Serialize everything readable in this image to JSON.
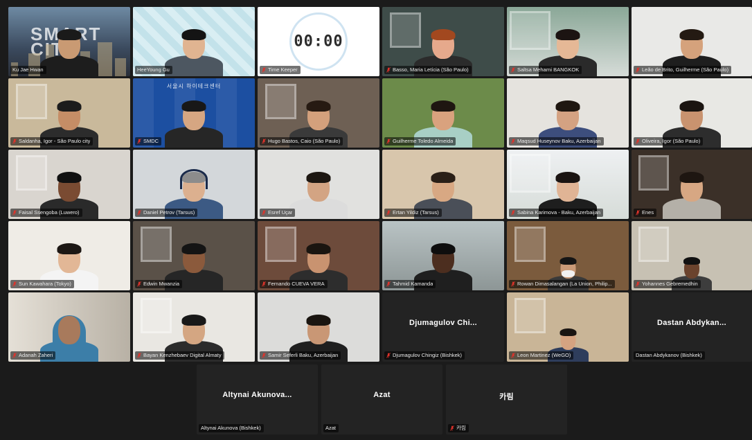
{
  "meeting": {
    "participants": [
      {
        "id": "p01",
        "name": "Ku Jae Hwan",
        "video": true,
        "mic_muted": false,
        "active_speaker": false,
        "bg": "#2d3a4e",
        "skin": "#c99a73",
        "hair": "#1a1a1a",
        "shirt": "#1d1d1d",
        "scene": "smartcity"
      },
      {
        "id": "p02",
        "name": "HeeYoung Gu",
        "video": true,
        "mic_muted": false,
        "active_speaker": true,
        "bg": "#cfe6ee",
        "skin": "#e0b491",
        "hair": "#141414",
        "shirt": "#4d5761",
        "scene": "pattern"
      },
      {
        "id": "p03",
        "name": "Time Keeper",
        "video": true,
        "mic_muted": true,
        "active_speaker": false,
        "bg": "#ffffff",
        "scene": "timer",
        "timer": "00:00"
      },
      {
        "id": "p04",
        "name": "Basso, Maria Letícia (São Paulo)",
        "video": true,
        "mic_muted": true,
        "active_speaker": false,
        "bg": "#3e4c49",
        "skin": "#e6a98c",
        "hair": "#a2481f",
        "shirt": "#2b2b2b",
        "scene": "room"
      },
      {
        "id": "p05",
        "name": "Saltsa Meharni BANGKOK",
        "video": true,
        "mic_muted": true,
        "active_speaker": false,
        "bg": "#8aa797",
        "skin": "#e5b896",
        "hair": "#1c1412",
        "shirt": "#2a2a2a",
        "scene": "office"
      },
      {
        "id": "p06",
        "name": "Leão de Brito, Guilherme (São Paulo)",
        "video": true,
        "mic_muted": true,
        "active_speaker": false,
        "bg": "#e9e9e7",
        "skin": "#d5a27c",
        "hair": "#241a13",
        "shirt": "#1e1e1e",
        "scene": "plain"
      },
      {
        "id": "p07",
        "name": "Saldanha, Igor - São Paulo city",
        "video": true,
        "mic_muted": true,
        "active_speaker": false,
        "bg": "#c9b99b",
        "skin": "#c58d66",
        "hair": "#1c1c1c",
        "shirt": "#2c2c2c",
        "scene": "room"
      },
      {
        "id": "p08",
        "name": "SMDC",
        "video": true,
        "mic_muted": true,
        "active_speaker": false,
        "bg": "#1c4fa1",
        "skin": "#d6a682",
        "hair": "#181818",
        "shirt": "#262626",
        "scene": "banner",
        "banner_text": "서울시 하이테크센터"
      },
      {
        "id": "p09",
        "name": "Hugo Bastos, Caio (São Paulo)",
        "video": true,
        "mic_muted": true,
        "active_speaker": false,
        "bg": "#6e6054",
        "skin": "#d3a07c",
        "hair": "#261a12",
        "shirt": "#3a3a3a",
        "scene": "room"
      },
      {
        "id": "p10",
        "name": "Guilherme Toledo Almeida",
        "video": true,
        "mic_muted": true,
        "active_speaker": false,
        "bg": "#6c8b4a",
        "skin": "#d9a27e",
        "hair": "#1e1611",
        "shirt": "#a8cfc5",
        "scene": "plain"
      },
      {
        "id": "p11",
        "name": "Maqsud Huseynov Baku, Azerbaijan",
        "video": true,
        "mic_muted": true,
        "active_speaker": false,
        "bg": "#e5e3de",
        "skin": "#d4a282",
        "hair": "#1f1711",
        "shirt": "#3d4e7d",
        "scene": "plain"
      },
      {
        "id": "p12",
        "name": "Oliveira, Igor (São Paulo)",
        "video": true,
        "mic_muted": true,
        "active_speaker": false,
        "bg": "#e8e8e4",
        "skin": "#c9936f",
        "hair": "#1a1410",
        "shirt": "#2d2d2d",
        "scene": "plain"
      },
      {
        "id": "p13",
        "name": "Faisal Ssengoba (Luwero)",
        "video": true,
        "mic_muted": true,
        "active_speaker": false,
        "bg": "#d9d5cf",
        "skin": "#7a4b32",
        "hair": "#111111",
        "shirt": "#2a2a2a",
        "scene": "room"
      },
      {
        "id": "p14",
        "name": "Daniel Petrov (Tarsus)",
        "video": true,
        "mic_muted": true,
        "active_speaker": false,
        "bg": "#d3d7da",
        "skin": "#dcb08f",
        "hair": "#8c8c8c",
        "shirt": "#3c5a84",
        "scene": "plain",
        "headset": true
      },
      {
        "id": "p15",
        "name": "Esref Uçar",
        "video": true,
        "mic_muted": true,
        "active_speaker": false,
        "bg": "#e1e1df",
        "skin": "#d3a483",
        "hair": "#1d1712",
        "shirt": "#dcdcdc",
        "scene": "plain"
      },
      {
        "id": "p16",
        "name": "Ertan Yildiz (Tarsus)",
        "video": true,
        "mic_muted": true,
        "active_speaker": false,
        "bg": "#d8c6ac",
        "skin": "#d8a883",
        "hair": "#2a1f17",
        "shirt": "#4a4f58",
        "scene": "plain"
      },
      {
        "id": "p17",
        "name": "Sabina Karimova - Baku, Azerbaijan",
        "video": true,
        "mic_muted": true,
        "active_speaker": false,
        "bg": "#eef0f2",
        "skin": "#e0b495",
        "hair": "#1a1412",
        "shirt": "#1e1e1e",
        "scene": "office"
      },
      {
        "id": "p18",
        "name": "Enes",
        "video": true,
        "mic_muted": true,
        "active_speaker": false,
        "bg": "#3b3028",
        "skin": "#d7a783",
        "hair": "#1e1611",
        "shirt": "#b4b0a8",
        "scene": "room"
      },
      {
        "id": "p19",
        "name": "Sun Kawahara (Tokyo)",
        "video": true,
        "mic_muted": true,
        "active_speaker": false,
        "bg": "#efece6",
        "skin": "#e2b796",
        "hair": "#1c1714",
        "shirt": "#f4f4f4",
        "scene": "plain"
      },
      {
        "id": "p20",
        "name": "Edwin Mwanzia",
        "video": true,
        "mic_muted": true,
        "active_speaker": false,
        "bg": "#5a5148",
        "skin": "#8b5a3c",
        "hair": "#141414",
        "shirt": "#262626",
        "scene": "room"
      },
      {
        "id": "p21",
        "name": "Fernando CUEVA VERA",
        "video": true,
        "mic_muted": true,
        "active_speaker": false,
        "bg": "#6d4b3b",
        "skin": "#c99370",
        "hair": "#1a1510",
        "shirt": "#2d2d2d",
        "scene": "room"
      },
      {
        "id": "p22",
        "name": "Tahmid Kamanda",
        "video": true,
        "mic_muted": true,
        "active_speaker": false,
        "bg": "#9ea7a5",
        "skin": "#4c2e1f",
        "hair": "#0e0e0e",
        "shirt": "#1f1f1f",
        "scene": "car"
      },
      {
        "id": "p23",
        "name": "Rowan Dimasalangan (La Union, Philip...",
        "video": true,
        "mic_muted": true,
        "active_speaker": false,
        "bg": "#7b5b3d",
        "skin": "#c99a78",
        "hair": "#151515",
        "shirt": "#3a3a3a",
        "scene": "room",
        "mask": true,
        "small": true
      },
      {
        "id": "p24",
        "name": "Yohannes Gebremedhin",
        "video": true,
        "mic_muted": true,
        "active_speaker": false,
        "bg": "#c7c1b3",
        "skin": "#6b432d",
        "hair": "#111111",
        "shirt": "#3d3d3d",
        "scene": "room",
        "small": true
      },
      {
        "id": "p25",
        "name": "Adanah Zaheri",
        "video": true,
        "mic_muted": true,
        "active_speaker": false,
        "bg": "#ccc6bc",
        "skin": "#a87a5c",
        "hair": "#3c7ea8",
        "shirt": "#3c7ea8",
        "scene": "hijab"
      },
      {
        "id": "p26",
        "name": "Bayan Kenzhebaev Digital Almaty",
        "video": true,
        "mic_muted": true,
        "active_speaker": false,
        "bg": "#e9e7e2",
        "skin": "#d4a682",
        "hair": "#181818",
        "shirt": "#2b2b2b",
        "scene": "room"
      },
      {
        "id": "p27",
        "name": "Samir Seferli Baku, Azerbaijan",
        "video": true,
        "mic_muted": true,
        "active_speaker": false,
        "bg": "#dcdcda",
        "skin": "#c99775",
        "hair": "#1a1510",
        "shirt": "#1f1f1f",
        "scene": "plain"
      },
      {
        "id": "p28",
        "name": "Djumagulov Chingiz (Bishkek)",
        "display_name": "Djumagulov Chi...",
        "video": false,
        "mic_muted": true,
        "active_speaker": false
      },
      {
        "id": "p29",
        "name": "Leon Martinez (WeGO)",
        "video": true,
        "mic_muted": true,
        "active_speaker": false,
        "bg": "#c9b597",
        "skin": "#d5a381",
        "hair": "#1a1512",
        "shirt": "#2e3d5c",
        "scene": "room",
        "small": true
      },
      {
        "id": "p30",
        "name": "Dastan Abdykanov (Bishkek)",
        "display_name": "Dastan Abdykan...",
        "video": false,
        "mic_muted": false,
        "active_speaker": false
      },
      {
        "id": "p31",
        "name": "Altynai Akunova (Bishkek)",
        "display_name": "Altynai Akunova...",
        "video": false,
        "mic_muted": false,
        "active_speaker": false
      },
      {
        "id": "p32",
        "name": "Azat",
        "display_name": "Azat",
        "video": false,
        "mic_muted": false,
        "active_speaker": false
      },
      {
        "id": "p33",
        "name": "카림",
        "display_name": "카림",
        "video": false,
        "mic_muted": true,
        "active_speaker": false
      }
    ]
  },
  "colors": {
    "muted_mic": "#e0332b",
    "active_speaker_border": "#b9e07a",
    "background": "#1b1b1b"
  },
  "icons": {
    "mic_muted": "mic-muted-icon",
    "timer": "timer-clock-icon"
  }
}
